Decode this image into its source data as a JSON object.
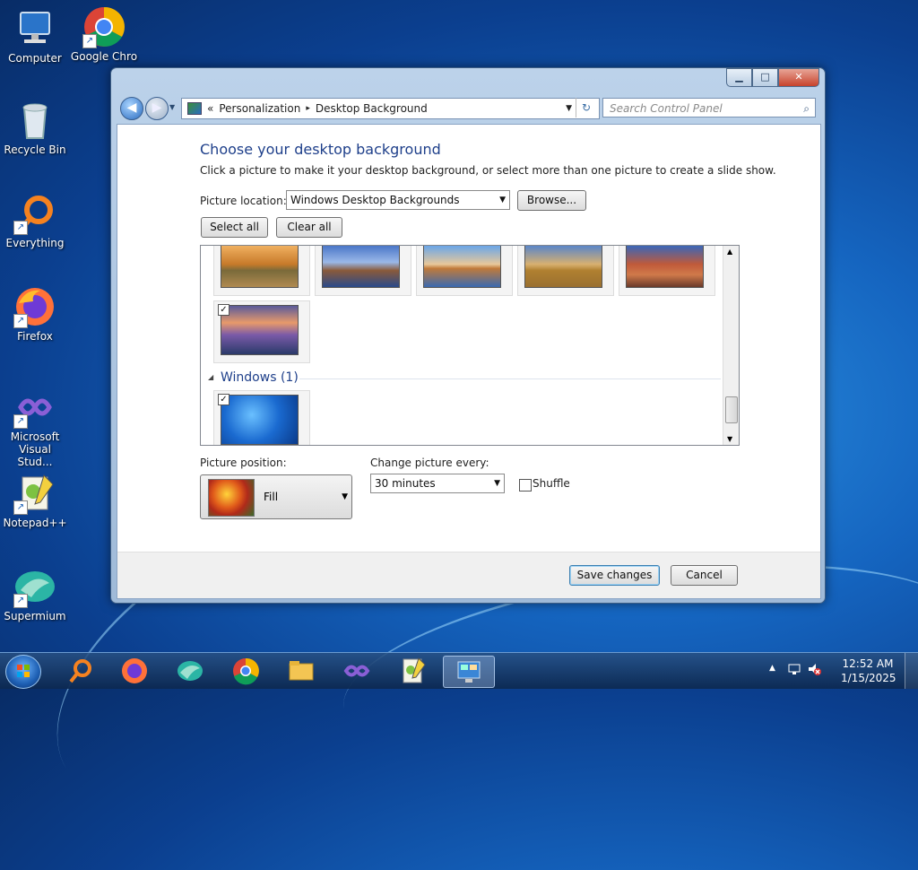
{
  "desktop": {
    "icons": [
      {
        "label": "Computer"
      },
      {
        "label": "Google Chro"
      },
      {
        "label": "Recycle Bin"
      },
      {
        "label": "Everything"
      },
      {
        "label": "Firefox"
      },
      {
        "label": "Microsoft Visual Stud..."
      },
      {
        "label": "Notepad++"
      },
      {
        "label": "Supermium"
      }
    ]
  },
  "window": {
    "controls": {
      "minimize": "▁",
      "maximize": "□",
      "close": "✕"
    },
    "breadcrumb": {
      "root_glyph": "«",
      "items": [
        "Personalization",
        "Desktop Background"
      ],
      "sep": "▸"
    },
    "search_placeholder": "Search Control Panel",
    "heading": "Choose your desktop background",
    "subtext": "Click a picture to make it your desktop background, or select more than one picture to create a slide show.",
    "picture_location": {
      "label": "Picture location:",
      "value": "Windows Desktop Backgrounds",
      "browse": "Browse..."
    },
    "select_all": "Select all",
    "clear_all": "Clear all",
    "group_windows": "Windows (1)",
    "picture_position": {
      "label": "Picture position:",
      "value": "Fill"
    },
    "change_every": {
      "label": "Change picture every:",
      "value": "30 minutes"
    },
    "shuffle": "Shuffle",
    "save": "Save changes",
    "cancel": "Cancel"
  },
  "taskbar": {
    "clock_time": "12:52 AM",
    "clock_date": "1/15/2025"
  },
  "colors": {
    "accent": "#1e3f8a",
    "taskbar": "#12355f"
  }
}
